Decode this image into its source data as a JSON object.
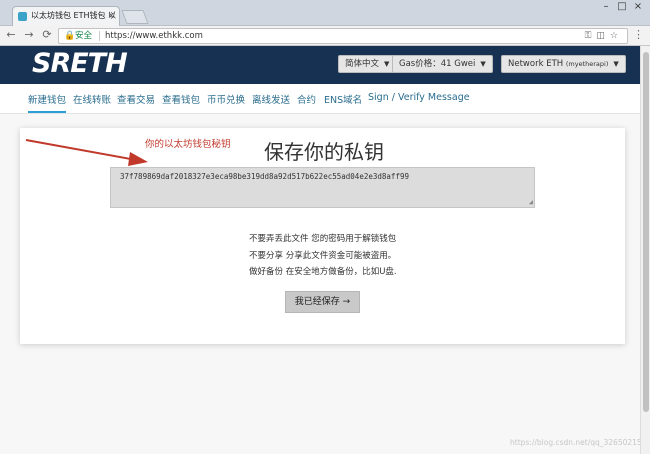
{
  "browser": {
    "tab_title": "以太坊钱包 ETH钱包 以",
    "tab_close": "×",
    "window_minimize": "–",
    "window_maximize": "□",
    "window_close": "×",
    "secure_label": "安全",
    "url": "https://www.ethkk.com"
  },
  "header": {
    "logo": "SRETH",
    "language_dropdown": "简体中文",
    "gas_dropdown": "Gas价格：41 Gwei",
    "network_dropdown": "Network ETH",
    "network_node": "(myetherapi)"
  },
  "nav": {
    "items": [
      "新建钱包",
      "在线转账",
      "查看交易",
      "查看钱包",
      "币币兑换",
      "离线发送",
      "合约",
      "ENS域名",
      "Sign / Verify Message"
    ]
  },
  "main": {
    "annotation": "你的以太坊钱包秘钥",
    "title": "保存你的私钥",
    "private_key": "37f789869daf2018327e3eca98be319dd8a92d517b622ec55ad04e2e3d8aff99",
    "warnings": [
      "不要弄丢此文件 您的密码用于解锁钱包",
      "不要分享 分享此文件资金可能被盗用。",
      "做好备份 在安全地方做备份，比如U盘."
    ],
    "save_button": "我已经保存 →"
  },
  "watermark": "https://blog.csdn.net/qq_32650215",
  "colors": {
    "header_bg": "#163151",
    "nav_link": "#2a6d8e",
    "annotation": "#c0392b"
  }
}
